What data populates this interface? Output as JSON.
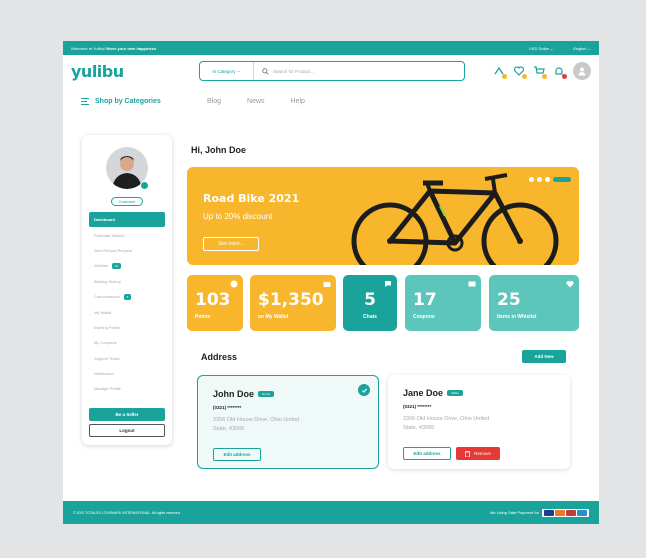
{
  "topbar": {
    "welcome_prefix": "Welcome to Yulibu!",
    "welcome_bold": "Move your own happiness",
    "currency": "USD Dollar",
    "language": "English"
  },
  "header": {
    "logo": "yulibu",
    "category_label": "In Category",
    "search_placeholder": "Search for Product..."
  },
  "nav": {
    "shop_label": "Shop by Categories",
    "links": [
      "Blog",
      "News",
      "Help"
    ]
  },
  "sidebar": {
    "badge": "Customer",
    "items": [
      {
        "label": "Dashboard",
        "active": true
      },
      {
        "label": "Purchase History"
      },
      {
        "label": "Sent Refund Request"
      },
      {
        "label": "Wishlist",
        "badge": "10"
      },
      {
        "label": "Bidding History"
      },
      {
        "label": "Conversations",
        "badge": "5"
      },
      {
        "label": "My Wallet"
      },
      {
        "label": "Earning Points"
      },
      {
        "label": "My Coupons"
      },
      {
        "label": "Support Ticket"
      },
      {
        "label": "Notification"
      },
      {
        "label": "Manage Profile"
      }
    ],
    "seller_button": "Be a Seller",
    "logout_button": "Logout"
  },
  "main": {
    "greeting": "Hi, John Doe",
    "banner": {
      "title": "Road Bike 2021",
      "subtitle": "Up to 20% discount",
      "cta": "See more..."
    },
    "stats": [
      {
        "value": "103",
        "label": "Points"
      },
      {
        "value": "$1,350",
        "label": "on My Wallet"
      },
      {
        "value": "5",
        "label": "Chats"
      },
      {
        "value": "17",
        "label": "Coupons"
      },
      {
        "value": "25",
        "label": "Items in Whislist"
      }
    ],
    "address_title": "Address",
    "add_new": "Add New",
    "addresses": [
      {
        "name": "John Doe",
        "tag": "Home",
        "phone": "(0321) ********",
        "line1": "2356 Old House Drive, Ohio United",
        "line2": "State, 43065",
        "edit": "Edit address"
      },
      {
        "name": "Jane Doe",
        "tag": "Office",
        "phone": "(0321) ********",
        "line1": "2356 Old House Drive, Ohio United",
        "line2": "State, 43065",
        "edit": "Edit address",
        "remove": "Remove"
      }
    ]
  },
  "footer": {
    "copyright": "© 2021 TOTALES LOVEMARK INTERNATIONAL. All rights reserved",
    "payment_label": "We Using Safe Payment for"
  },
  "colors": {
    "primary": "#1aa39a",
    "accent": "#f7b62b",
    "teal_light": "#5cc6bd",
    "danger": "#e53935"
  }
}
